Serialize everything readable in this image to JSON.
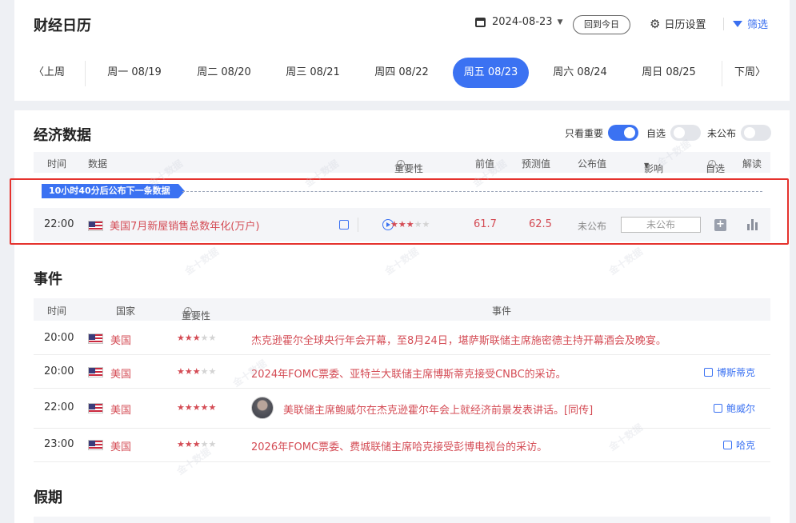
{
  "header": {
    "title": "财经日历",
    "date": "2024-08-23",
    "today_label": "回到今日",
    "settings_label": "日历设置",
    "filter_label": "筛选"
  },
  "week": {
    "prev": "上周",
    "next": "下周",
    "days": [
      "周一 08/19",
      "周二 08/20",
      "周三 08/21",
      "周四 08/22",
      "周五 08/23",
      "周六 08/24",
      "周日 08/25"
    ],
    "active_index": 4
  },
  "econ": {
    "title": "经济数据",
    "toggles": [
      {
        "label": "只看重要",
        "on": true
      },
      {
        "label": "自选",
        "on": false
      },
      {
        "label": "未公布",
        "on": false
      }
    ],
    "columns": [
      "时间",
      "数据",
      "重要性",
      "前值",
      "预测值",
      "公布值",
      "影响",
      "自选",
      "解读"
    ],
    "countdown": "10小时40分后公布下一条数据",
    "rows": [
      {
        "time": "22:00",
        "name": "美国7月新屋销售总数年化(万户)",
        "stars": 3,
        "prev": "61.7",
        "forecast": "62.5",
        "actual": "未公布",
        "impact": "未公布"
      }
    ]
  },
  "events": {
    "title": "事件",
    "columns": [
      "时间",
      "国家",
      "重要性",
      "事件"
    ],
    "rows": [
      {
        "time": "20:00",
        "country": "美国",
        "stars": 3,
        "text": "杰克逊霍尔全球央行年会开幕，至8月24日，堪萨斯联储主席施密德主持开幕酒会及晚宴。",
        "related": ""
      },
      {
        "time": "20:00",
        "country": "美国",
        "stars": 3,
        "text": "2024年FOMC票委、亚特兰大联储主席博斯蒂克接受CNBC的采访。",
        "related": "博斯蒂克"
      },
      {
        "time": "22:00",
        "country": "美国",
        "stars": 5,
        "text": "美联储主席鲍威尔在杰克逊霍尔年会上就经济前景发表讲话。[同传]",
        "related": "鲍威尔"
      },
      {
        "time": "23:00",
        "country": "美国",
        "stars": 3,
        "text": "2026年FOMC票委、费城联储主席哈克接受彭博电视台的采访。",
        "related": "哈克"
      }
    ]
  },
  "holidays": {
    "title": "假期"
  },
  "watermark": "金十数据",
  "colors": {
    "accent": "#3b72f2",
    "red": "#d44c55",
    "highlight_border": "#e5322d"
  }
}
